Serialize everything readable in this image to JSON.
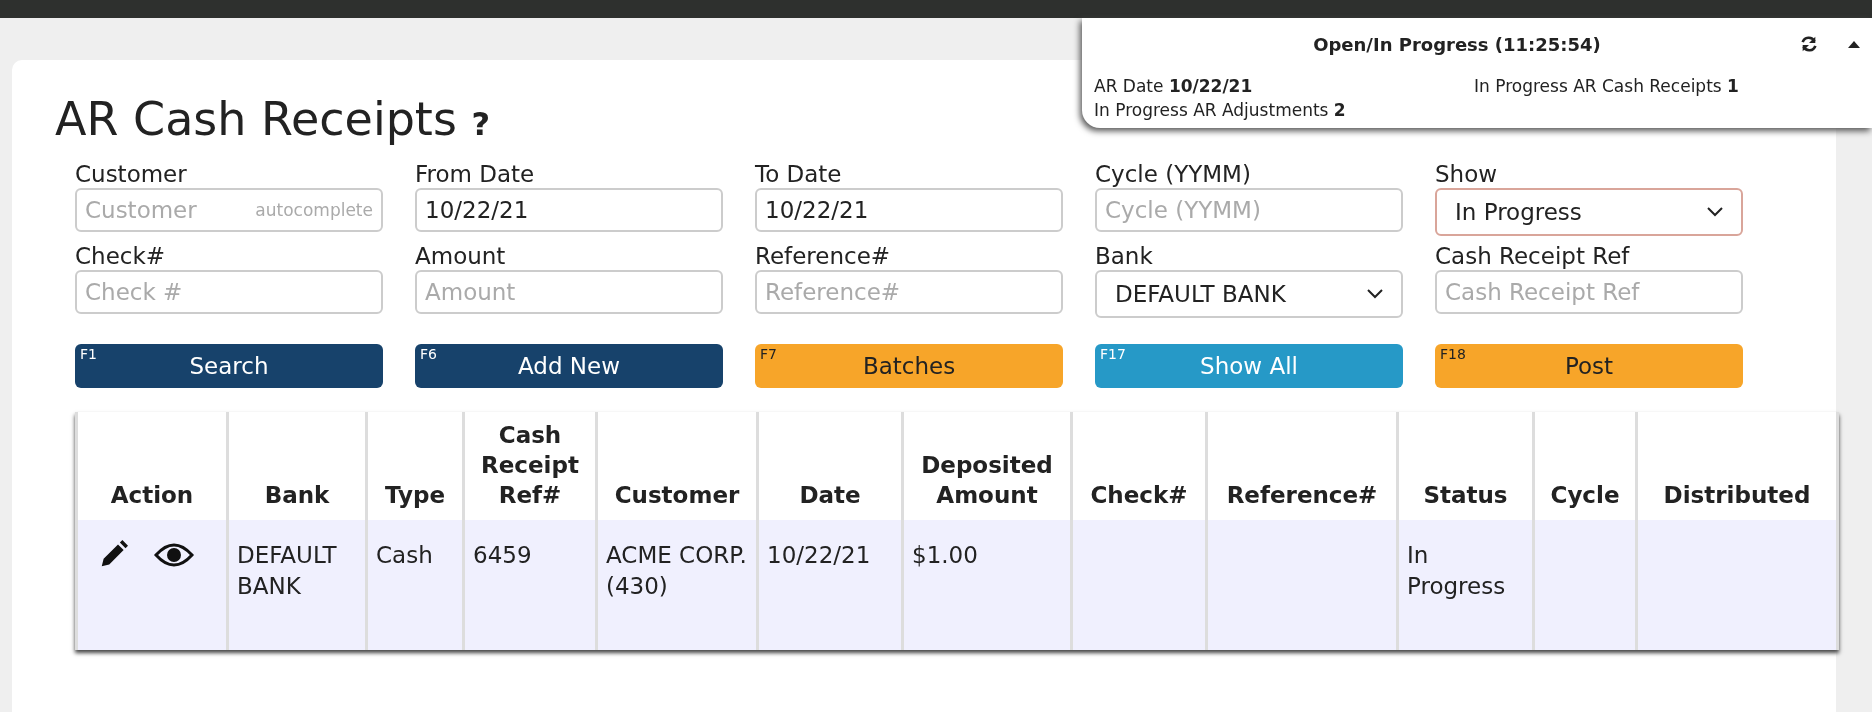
{
  "page": {
    "title": "AR Cash Receipts",
    "help": "?"
  },
  "status_panel": {
    "title": "Open/In Progress (11:25:54)",
    "items": [
      "AR Date **10/22/21**",
      "In Progress AR Cash Receipts **1**",
      "In Progress AR Adjustments **2**"
    ]
  },
  "filters": [
    {
      "label": "Customer",
      "kind": "text",
      "placeholder": "Customer",
      "hint": "autocomplete"
    },
    {
      "label": "From Date",
      "kind": "text",
      "value": "10/22/21"
    },
    {
      "label": "To Date",
      "kind": "text",
      "value": "10/22/21"
    },
    {
      "label": "Cycle (YYMM)",
      "kind": "text",
      "placeholder": "Cycle (YYMM)"
    },
    {
      "label": "Show",
      "kind": "select",
      "value": "In Progress",
      "focused": true
    },
    {
      "label": "Check#",
      "kind": "text",
      "placeholder": "Check #"
    },
    {
      "label": "Amount",
      "kind": "text",
      "placeholder": "Amount"
    },
    {
      "label": "Reference#",
      "kind": "text",
      "placeholder": "Reference#"
    },
    {
      "label": "Bank",
      "kind": "select",
      "value": "DEFAULT BANK",
      "focused": false
    },
    {
      "label": "Cash Receipt Ref",
      "kind": "text",
      "placeholder": "Cash Receipt Ref"
    }
  ],
  "buttons": [
    {
      "key": "F1",
      "label": "Search",
      "kind": "primary"
    },
    {
      "key": "F6",
      "label": "Add New",
      "kind": "primary"
    },
    {
      "key": "F7",
      "label": "Batches",
      "kind": "warning"
    },
    {
      "key": "F17",
      "label": "Show All",
      "kind": "info"
    },
    {
      "key": "F18",
      "label": "Post",
      "kind": "warning"
    }
  ],
  "table": {
    "columns": [
      "Action",
      "Bank",
      "Type",
      "Cash Receipt Ref#",
      "Customer",
      "Date",
      "Deposited Amount",
      "Check#",
      "Reference#",
      "Status",
      "Cycle",
      "Distributed"
    ],
    "rows": [
      {
        "cells": {
          "1": "DEFAULT BANK",
          "2": "Cash",
          "3": "6459",
          "4": "ACME CORP. (430)",
          "5": "10/22/21",
          "6": "$1.00",
          "9": "In Progress"
        }
      }
    ]
  }
}
